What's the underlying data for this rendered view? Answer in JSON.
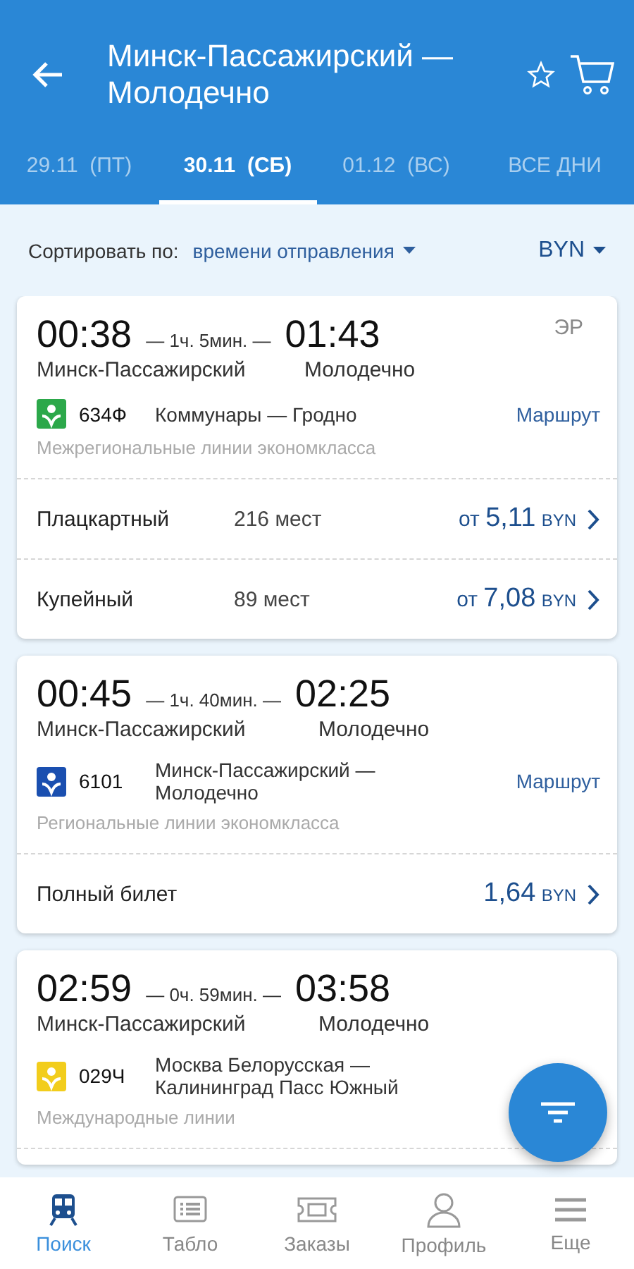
{
  "header": {
    "title": "Минск-Пассажирский — Молодечно"
  },
  "tabs": [
    {
      "label": "29.11  (ПТ)",
      "selected": false
    },
    {
      "label": "30.11  (СБ)",
      "selected": true
    },
    {
      "label": "01.12  (ВС)",
      "selected": false
    },
    {
      "label": "ВСЕ ДНИ",
      "selected": false
    }
  ],
  "sort": {
    "label": "Сортировать по:",
    "value": "времени отправления",
    "currency": "BYN"
  },
  "trains": [
    {
      "departure": "00:38",
      "duration": "— 1ч. 5мин. —",
      "arrival": "01:43",
      "from": "Минск-Пассажирский",
      "to": "Молодечно",
      "code": "ЭР",
      "color": "#2ca84a",
      "number": "634Ф",
      "route": "Коммунары — Гродно",
      "route_link": "Маршрут",
      "category": "Межрегиональные линии экономкласса",
      "fares": [
        {
          "name": "Плацкартный",
          "seats": "216 мест",
          "prefix": "от",
          "price": "5,11",
          "currency": "BYN"
        },
        {
          "name": "Купейный",
          "seats": "89 мест",
          "prefix": "от",
          "price": "7,08",
          "currency": "BYN"
        }
      ]
    },
    {
      "departure": "00:45",
      "duration": "— 1ч. 40мин. —",
      "arrival": "02:25",
      "from": "Минск-Пассажирский",
      "to": "Молодечно",
      "color": "#1a4fb0",
      "number": "6101",
      "route": "Минск-Пассажирский — Молодечно",
      "route_link": "Маршрут",
      "category": "Региональные линии экономкласса",
      "fares": [
        {
          "name": "Полный билет",
          "price": "1,64",
          "currency": "BYN"
        }
      ]
    },
    {
      "departure": "02:59",
      "duration": "— 0ч. 59мин. —",
      "arrival": "03:58",
      "from": "Минск-Пассажирский",
      "to": "Молодечно",
      "color": "#f2cd1c",
      "number": "029Ч",
      "route": "Москва Белорусская — Калининград Пасс Южный",
      "category": "Международные линии"
    }
  ],
  "nav": [
    {
      "label": "Поиск",
      "selected": true
    },
    {
      "label": "Табло",
      "selected": false
    },
    {
      "label": "Заказы",
      "selected": false
    },
    {
      "label": "Профиль",
      "selected": false
    },
    {
      "label": "Еще",
      "selected": false
    }
  ]
}
